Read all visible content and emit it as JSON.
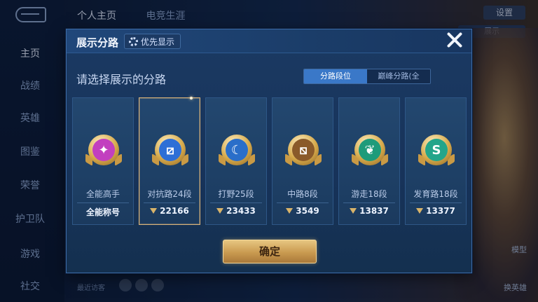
{
  "background": {
    "tabs": [
      "个人主页",
      "电竞生涯"
    ],
    "nav": [
      "主页",
      "战绩",
      "英雄",
      "图鉴",
      "荣誉",
      "护卫队",
      "游戏",
      "社交"
    ],
    "top_right_button": "设置",
    "top_right_sub": "展示",
    "recent_label": "最近访客",
    "right_labels": [
      "模型",
      "换英雄"
    ]
  },
  "dialog": {
    "title": "展示分路",
    "priority_label": "优先显示",
    "subtitle": "请选择展示的分路",
    "toggle": {
      "active": "分路段位",
      "inactive": "巅峰分路(全国)"
    },
    "cards": [
      {
        "title": "全能高手",
        "value": "全能称号",
        "icon": "allround-badge-icon",
        "color": "#c23fbf",
        "selected": false,
        "show_score_icon": false
      },
      {
        "title": "对抗路24段",
        "value": "22166",
        "icon": "clash-lane-badge-icon",
        "color": "#2d6fd6",
        "selected": true,
        "show_score_icon": true
      },
      {
        "title": "打野25段",
        "value": "23433",
        "icon": "jungle-badge-icon",
        "color": "#2a6ec9",
        "selected": false,
        "show_score_icon": true
      },
      {
        "title": "中路8段",
        "value": "3549",
        "icon": "mid-lane-badge-icon",
        "color": "#8a5a2a",
        "selected": false,
        "show_score_icon": true
      },
      {
        "title": "游走18段",
        "value": "13837",
        "icon": "roam-badge-icon",
        "color": "#1e9b7a",
        "selected": false,
        "show_score_icon": true
      },
      {
        "title": "发育路18段",
        "value": "13377",
        "icon": "farm-lane-badge-icon",
        "color": "#23a58a",
        "selected": false,
        "show_score_icon": true
      }
    ],
    "confirm_label": "确定"
  }
}
